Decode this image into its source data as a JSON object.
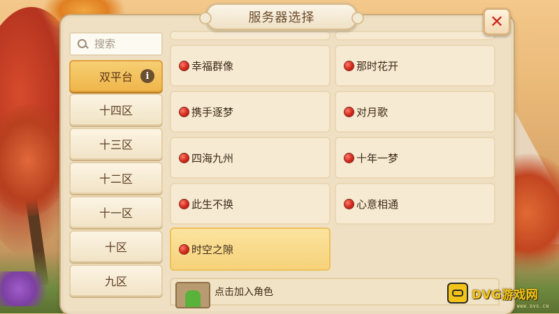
{
  "header": {
    "title": "服务器选择"
  },
  "close": {
    "label": "✕"
  },
  "search": {
    "placeholder": "搜索"
  },
  "sidebar": {
    "items": [
      {
        "label": "双平台",
        "active": true,
        "info": "i"
      },
      {
        "label": "十四区"
      },
      {
        "label": "十三区"
      },
      {
        "label": "十二区"
      },
      {
        "label": "十一区"
      },
      {
        "label": "十区"
      },
      {
        "label": "九区"
      }
    ]
  },
  "servers": [
    {
      "name": "幸福群像",
      "status_color": "#d2281b"
    },
    {
      "name": "那时花开",
      "status_color": "#d2281b"
    },
    {
      "name": "携手逐梦",
      "status_color": "#d2281b"
    },
    {
      "name": "对月歌",
      "status_color": "#d2281b"
    },
    {
      "name": "四海九州",
      "status_color": "#d2281b"
    },
    {
      "name": "十年一梦",
      "status_color": "#d2281b"
    },
    {
      "name": "此生不换",
      "status_color": "#d2281b"
    },
    {
      "name": "心意相通",
      "status_color": "#d2281b"
    },
    {
      "name": "时空之隙",
      "status_color": "#d2281b",
      "selected": true
    }
  ],
  "footer": {
    "add_role_label": "点击加入角色"
  },
  "watermark": {
    "text": "DVG游戏网",
    "sub": "WWW.DVG.CN"
  },
  "colors": {
    "accent": "#efb64b",
    "status_red": "#d2281b",
    "panel": "#efe0c4"
  }
}
